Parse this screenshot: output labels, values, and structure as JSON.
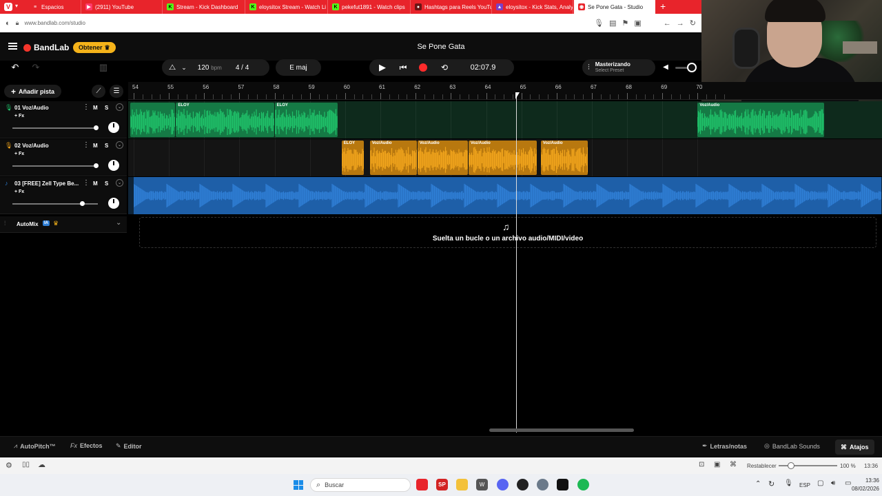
{
  "browser": {
    "tabs": [
      {
        "label": "Espacios",
        "active": false
      },
      {
        "label": "(2911) YouTube",
        "active": false
      },
      {
        "label": "Stream - Kick Dashboard",
        "active": false
      },
      {
        "label": "eloysitox Stream - Watch Li",
        "active": false
      },
      {
        "label": "pekefut1891 - Watch clips",
        "active": false
      },
      {
        "label": "Hashtags para Reels YouTu",
        "active": false
      },
      {
        "label": "eloysitox - Kick Stats, Analy",
        "active": false
      },
      {
        "label": "Se Pone Gata - Studio",
        "active": true
      }
    ],
    "url": "www.bandlab.com/studio",
    "zoom": "100 %",
    "reset_label": "Restablecer"
  },
  "app": {
    "logo": "BandLab",
    "get_button": "Obtener",
    "project_title": "Se Pone Gata",
    "tempo_value": "120",
    "tempo_unit": "bpm",
    "time_sig_num": "4",
    "time_sig_sep": "/",
    "time_sig_den": "4",
    "key": "E maj",
    "time_display": "02:07.9",
    "mastering_title": "Masterizando",
    "mastering_sub": "Select Preset",
    "add_track": "Añadir pista",
    "colors": {
      "accent": "#f5b31a",
      "green_clip": "#1fc26a",
      "yellow_clip": "#f2a51c",
      "blue_clip": "#2f7fd6",
      "record": "#ff2b2b"
    }
  },
  "ruler": {
    "bars": [
      "54",
      "55",
      "56",
      "57",
      "58",
      "59",
      "60",
      "61",
      "62",
      "63",
      "64",
      "65",
      "66",
      "67",
      "68",
      "69",
      "70"
    ]
  },
  "tracks": [
    {
      "number": "01",
      "name": "Voz/Audio",
      "fx": "+ Fx",
      "mute": "M",
      "solo": "S",
      "volume": 0.98,
      "color": "#1fc26a",
      "icon": "mic-icon",
      "clips": [
        {
          "label": "",
          "start_bar": 53.9,
          "end_bar": 55.2
        },
        {
          "label": "ELOY",
          "start_bar": 55.2,
          "end_bar": 58.0
        },
        {
          "label": "ELOY",
          "start_bar": 58.0,
          "end_bar": 59.8
        },
        {
          "label": "Voz/Audio",
          "start_bar": 70.0,
          "end_bar": 73.6
        }
      ]
    },
    {
      "number": "02",
      "name": "Voz/Audio",
      "fx": "+ Fx",
      "mute": "M",
      "solo": "S",
      "volume": 0.98,
      "color": "#f2a51c",
      "icon": "mic-icon",
      "clips": [
        {
          "label": "ELOY",
          "start_bar": 59.9,
          "end_bar": 60.55
        },
        {
          "label": "Voz/Audio",
          "start_bar": 60.7,
          "end_bar": 62.05
        },
        {
          "label": "Voz/Audio",
          "start_bar": 62.05,
          "end_bar": 63.5
        },
        {
          "label": "Voz/Audio",
          "start_bar": 63.5,
          "end_bar": 65.45
        },
        {
          "label": "Voz/Audio",
          "start_bar": 65.55,
          "end_bar": 66.9
        }
      ]
    },
    {
      "number": "03",
      "name": "[FREE] Zell Type Be...",
      "fx": "+ Fx",
      "mute": "M",
      "solo": "S",
      "volume": 0.82,
      "color": "#2f7fd6",
      "icon": "music-note-icon",
      "clips": [
        {
          "label": "",
          "start_bar": 54.0,
          "end_bar": 75.5
        }
      ]
    }
  ],
  "automix": {
    "label": "AutoMix",
    "badge": "IA"
  },
  "dropzone": {
    "text": "Suelta un bucle o un archivo audio/MIDI/video"
  },
  "playhead_bar": 65.0,
  "bottom": {
    "autopitch": "AutoPitch™",
    "efectos": "Efectos",
    "editor": "Editor",
    "letras": "Letras/notas",
    "sounds": "BandLab Sounds",
    "atajos": "Atajos"
  },
  "taskbar": {
    "search": "Buscar",
    "lang": "ESP",
    "time": "13:36",
    "date": "08/02/2026",
    "status_time": "13:36"
  }
}
